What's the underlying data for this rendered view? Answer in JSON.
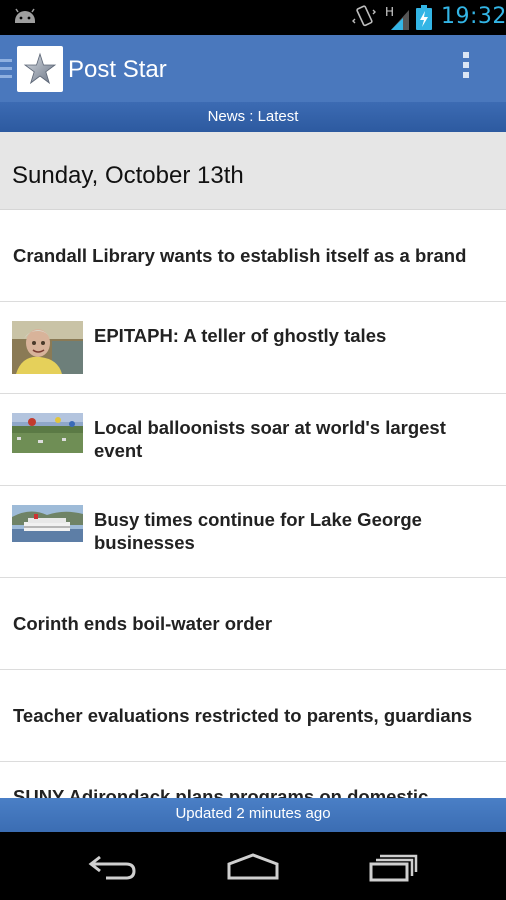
{
  "status_bar": {
    "time": "19:32",
    "network_type": "H",
    "icons": [
      "android-icon",
      "vibrate-icon",
      "signal-icon",
      "battery-charging-icon"
    ]
  },
  "action_bar": {
    "title": "Post Star",
    "logo": "star-logo-icon",
    "menu": "overflow-menu-icon"
  },
  "section": {
    "label": "News : Latest"
  },
  "date_header": "Sunday, October 13th",
  "news": [
    {
      "headline": "Crandall Library wants to establish itself as a brand",
      "thumb": null
    },
    {
      "headline": "EPITAPH: A teller of ghostly tales",
      "thumb": "person-photo"
    },
    {
      "headline": "Local balloonists soar at world's largest event",
      "thumb": "balloon-field-photo"
    },
    {
      "headline": "Busy times continue for Lake George businesses",
      "thumb": "steamboat-photo"
    },
    {
      "headline": "Corinth ends boil-water order",
      "thumb": null
    },
    {
      "headline": "Teacher evaluations restricted to parents, guardians",
      "thumb": null
    },
    {
      "headline": "SUNY Adirondack plans programs on domestic",
      "thumb": null
    }
  ],
  "footer": {
    "updated": "Updated 2 minutes ago"
  },
  "nav": [
    "back-icon",
    "home-icon",
    "recent-apps-icon"
  ],
  "colors": {
    "accent": "#4a78bd",
    "section_bar": "#2d5aa0",
    "clock": "#33b5e5",
    "date_header_bg": "#e6e6e6"
  }
}
